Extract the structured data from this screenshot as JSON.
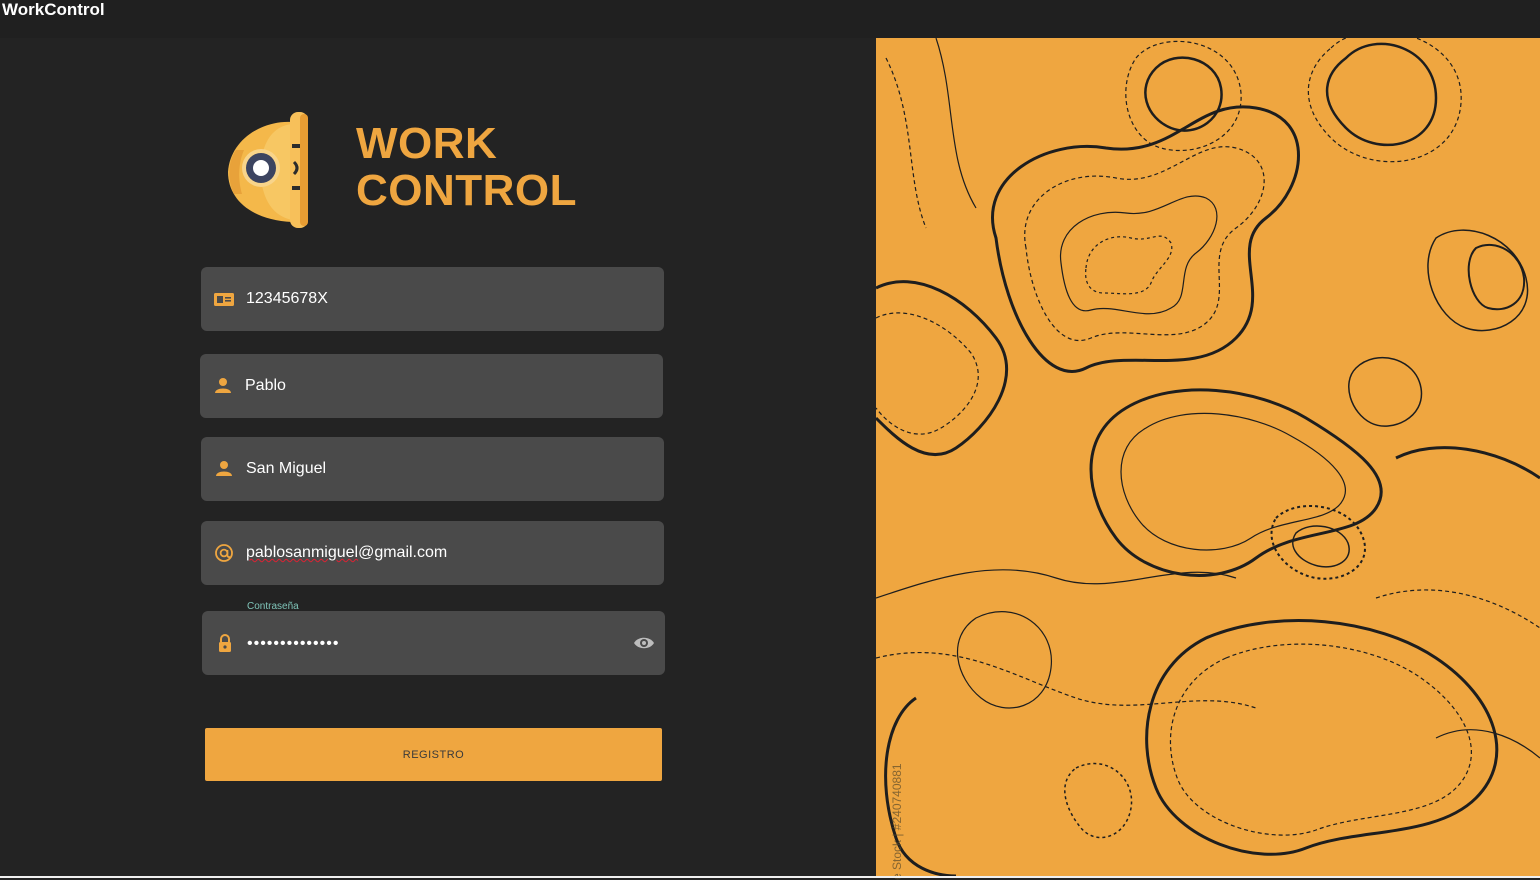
{
  "app": {
    "title": "WorkControl"
  },
  "brand": {
    "line1": "WORK",
    "line2": "CONTROL"
  },
  "form": {
    "dni": {
      "value": "12345678X",
      "icon": "id-card-icon"
    },
    "first_name": {
      "value": "Pablo",
      "icon": "person-icon"
    },
    "last_name": {
      "value": "San Miguel",
      "icon": "person-icon"
    },
    "email": {
      "value_user": "pablosanmiguel",
      "value_domain": "@gmail.com",
      "icon": "at-icon"
    },
    "password": {
      "label": "Contraseña",
      "value": "••••••••••••••",
      "icon": "lock-icon",
      "toggle_icon": "eye-icon"
    }
  },
  "register_button": {
    "label": "REGISTRO"
  },
  "watermark": {
    "text": "e Stock | #240740881"
  },
  "colors": {
    "accent": "#efa640",
    "field_bg": "#4a4a4a",
    "background": "#232323"
  }
}
